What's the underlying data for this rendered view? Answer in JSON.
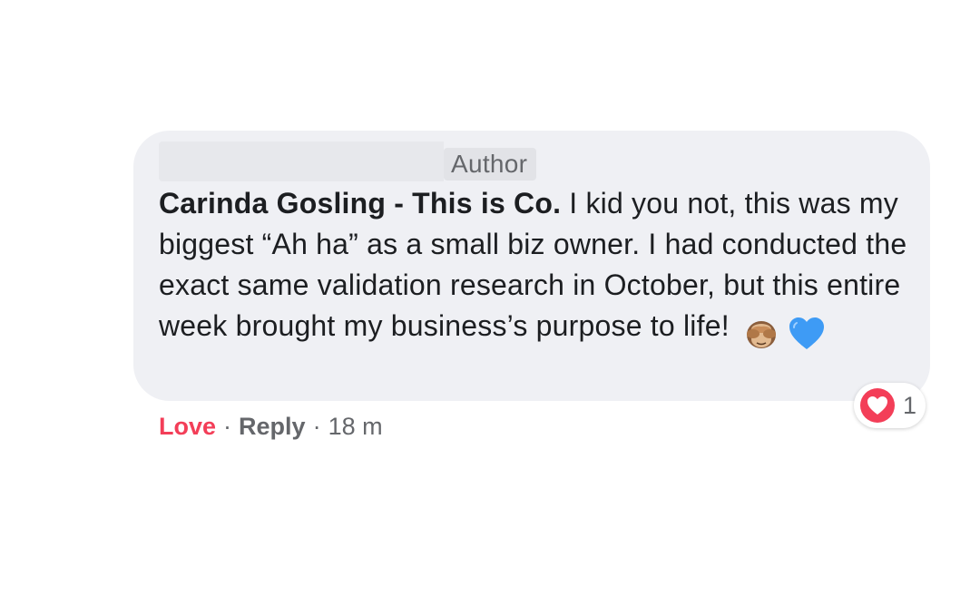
{
  "comment": {
    "author_badge": "Author",
    "author_name": "Carinda Gosling - This is Co.",
    "text": "I kid you not, this was my biggest “Ah ha” as a small biz owner. I had conducted the exact same validation research in October, but this entire week brought my business’s purpose to life!",
    "emojis": [
      "see-no-evil-monkey-icon",
      "blue-heart-icon"
    ]
  },
  "actions": {
    "love_label": "Love",
    "separator": "·",
    "reply_label": "Reply",
    "timestamp": "18 m"
  },
  "reactions": {
    "icon": "love-reaction-icon",
    "count": "1"
  },
  "colors": {
    "bubble_bg": "#eff0f4",
    "love_red": "#f33e58",
    "meta_gray": "#65676b",
    "text_dark": "#1c1e21"
  }
}
